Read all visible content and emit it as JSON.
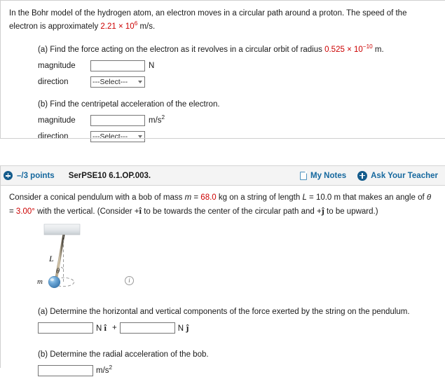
{
  "problem1": {
    "stem_pre": "In the Bohr model of the hydrogen atom, an electron moves in a circular path around a proton. The speed of the electron is approximately ",
    "stem_value": "2.21 × 10",
    "stem_exp": "6",
    "stem_post": " m/s.",
    "parts": [
      {
        "label": "(a) Find the force acting on the electron as it revolves in a circular orbit of radius ",
        "value": "0.525 × 10",
        "value_exp": "−10",
        "label_post": " m.",
        "magnitude_label": "magnitude",
        "magnitude_value": "",
        "magnitude_unit": "N",
        "direction_label": "direction",
        "direction_selected": "---Select---"
      },
      {
        "label": "(b) Find the centripetal acceleration of the electron.",
        "value": "",
        "value_exp": "",
        "label_post": "",
        "magnitude_label": "magnitude",
        "magnitude_value": "",
        "magnitude_unit_base": "m/s",
        "magnitude_unit_exp": "2",
        "direction_label": "direction",
        "direction_selected": "---Select---"
      }
    ]
  },
  "question_header": {
    "points": "–/3 points",
    "code": "SerPSE10 6.1.OP.003.",
    "my_notes_label": "My Notes",
    "ask_teacher_label": "Ask Your Teacher",
    "link_color": "#15689e",
    "icon_color": "#155c8c",
    "bar_background": "#f4f4f4"
  },
  "problem2": {
    "stem_1a": "Consider a conical pendulum with a bob of mass ",
    "stem_m": "m",
    "stem_1b": " = ",
    "stem_mass": "68.0",
    "stem_1c": " kg on a string of length ",
    "stem_L": "L",
    "stem_1d": " = 10.0 m that makes an angle of ",
    "stem_theta": "θ",
    "stem_1e": " = ",
    "stem_angle": "3.00°",
    "stem_2a": " with the vertical. (Consider +",
    "stem_ihat": "î",
    "stem_2b": " to be towards the center of the circular path and +",
    "stem_jhat": "ĵ",
    "stem_2c": " to be upward.)",
    "figure": {
      "label_L": "L",
      "label_theta": "θ",
      "label_m": "m",
      "ceiling_color": "#d9dde0",
      "string_color": "#b9a98e",
      "bob_color": "#5b9dd0",
      "info_glyph": "i"
    },
    "parts": [
      {
        "label": "(a) Determine the horizontal and vertical components of the force exerted by the string on the pendulum.",
        "field1_value": "",
        "unit1": "N",
        "vec1": "î",
        "plus": "+",
        "field2_value": "",
        "unit2": "N",
        "vec2": "ĵ"
      },
      {
        "label": "(b) Determine the radial acceleration of the bob.",
        "field1_value": "",
        "unit_base": "m/s",
        "unit_exp": "2"
      }
    ]
  }
}
